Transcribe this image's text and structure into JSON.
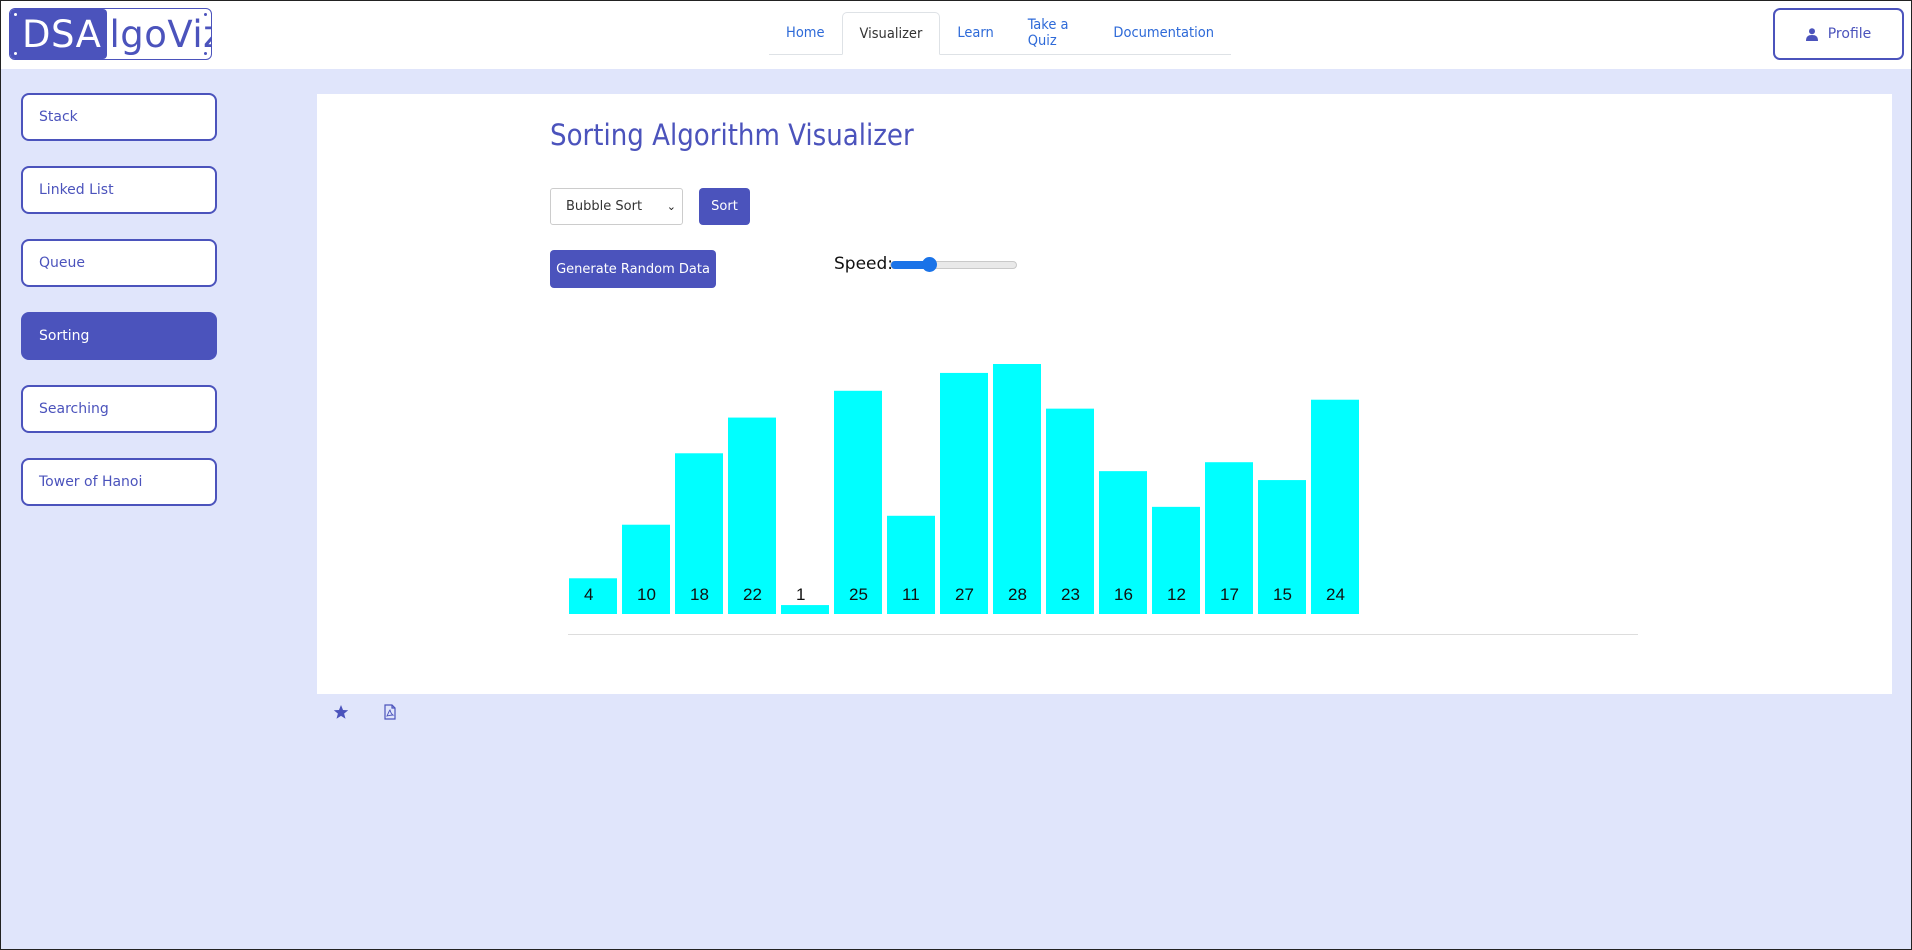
{
  "header": {
    "logo_prefix": "DSA",
    "logo_suffix": "lgoViz",
    "nav": [
      {
        "label": "Home",
        "active": false
      },
      {
        "label": "Visualizer",
        "active": true
      },
      {
        "label": "Learn",
        "active": false
      },
      {
        "label": "Take a Quiz",
        "active": false
      },
      {
        "label": "Documentation",
        "active": false
      }
    ],
    "profile_label": "Profile",
    "profile_icon": "user-icon"
  },
  "sidebar": {
    "items": [
      {
        "label": "Stack",
        "active": false
      },
      {
        "label": "Linked List",
        "active": false
      },
      {
        "label": "Queue",
        "active": false
      },
      {
        "label": "Sorting",
        "active": true
      },
      {
        "label": "Searching",
        "active": false
      },
      {
        "label": "Tower of Hanoi",
        "active": false
      }
    ]
  },
  "main": {
    "title": "Sorting Algorithm Visualizer",
    "algorithm_select": "Bubble Sort",
    "sort_button": "Sort",
    "generate_button": "Generate Random Data",
    "speed_label": "Speed:",
    "speed_value": 0.3
  },
  "chart_data": {
    "type": "bar",
    "categories": [
      "4",
      "10",
      "18",
      "22",
      "1",
      "25",
      "11",
      "27",
      "28",
      "23",
      "16",
      "12",
      "17",
      "15",
      "24"
    ],
    "values": [
      4,
      10,
      18,
      22,
      1,
      25,
      11,
      27,
      28,
      23,
      16,
      12,
      17,
      15,
      24
    ],
    "title": "",
    "xlabel": "",
    "ylabel": "",
    "bar_color": "#00ffff"
  },
  "footer": {
    "icons": [
      "star-icon",
      "pdf-file-icon"
    ]
  },
  "colors": {
    "accent": "#4b53bc",
    "background": "#e0e5fb",
    "link": "#2e6ad8",
    "slider": "#1a73e8"
  }
}
